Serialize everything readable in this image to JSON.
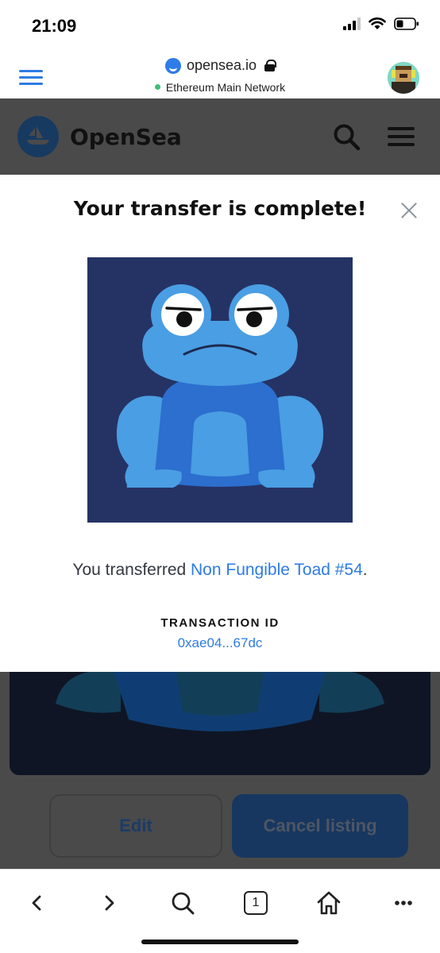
{
  "status_bar": {
    "time": "21:09"
  },
  "browser": {
    "url": "opensea.io",
    "network": "Ethereum Main Network",
    "tab_count": "1",
    "accent": "#2e7be4"
  },
  "site_header": {
    "brand": "OpenSea"
  },
  "modal": {
    "title": "Your transfer is complete!",
    "message_prefix": "You transferred ",
    "nft_name": "Non Fungible Toad #54",
    "message_suffix": ".",
    "transaction_label": "TRANSACTION ID",
    "transaction_id": "0xae04...67dc"
  },
  "actions": {
    "edit_label": "Edit",
    "cancel_listing_label": "Cancel listing"
  },
  "icons": {
    "back": "chevron-left-icon",
    "forward": "chevron-right-icon",
    "search": "search-icon",
    "tabs": "tabs-icon",
    "home": "home-icon",
    "more": "more-icon"
  }
}
